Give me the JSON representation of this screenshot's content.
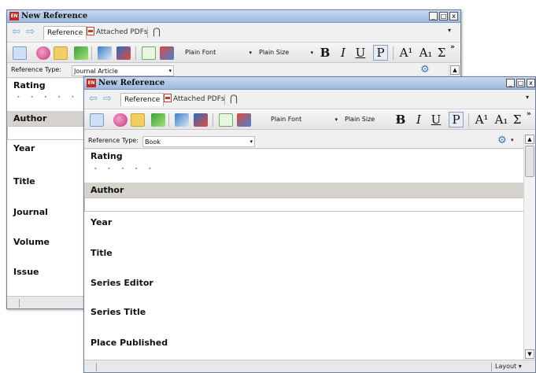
{
  "back_window": {
    "title": "New Reference",
    "app_icon_text": "EN",
    "tabs": {
      "reference": "Reference",
      "attached_pdfs": "Attached PDFs"
    },
    "toolbar": {
      "font": "Plain Font",
      "size": "Plain Size",
      "bold": "B",
      "italic": "I",
      "underline": "U",
      "plain": "P",
      "superscript": "A¹",
      "subscript": "A₁",
      "symbol": "Σ",
      "more": "»"
    },
    "reference_type_label": "Reference Type:",
    "reference_type_value": "Journal Article",
    "fields": [
      "Rating",
      "Author",
      "Year",
      "Title",
      "Journal",
      "Volume",
      "Issue"
    ]
  },
  "front_window": {
    "title": "New Reference",
    "app_icon_text": "EN",
    "tabs": {
      "reference": "Reference",
      "attached_pdfs": "Attached PDFs"
    },
    "toolbar": {
      "font": "Plain Font",
      "size": "Plain Size",
      "bold": "B",
      "italic": "I",
      "underline": "U",
      "plain": "P",
      "superscript": "A¹",
      "subscript": "A₁",
      "symbol": "Σ",
      "more": "»"
    },
    "reference_type_label": "Reference Type:",
    "reference_type_value": "Book",
    "fields": [
      "Rating",
      "Author",
      "Year",
      "Title",
      "Series Editor",
      "Series Title",
      "Place Published"
    ],
    "rating_stars": "• • • • •",
    "status": {
      "layout": "Layout"
    }
  },
  "controls": {
    "minimize": "_",
    "maximize": "□",
    "close": "x"
  },
  "glyphs": {
    "back": "⇦",
    "forward": "⇨",
    "clip": "⋂",
    "dropdown": "▾",
    "gear": "⚙",
    "scroll_up": "▲",
    "scroll_down": "▼"
  },
  "colors": {
    "title_gradient_top": "#c7d9f1",
    "title_gradient_bottom": "#9fb9df",
    "section_band": "#d6d3cf",
    "accent_blue": "#3a78b8"
  }
}
